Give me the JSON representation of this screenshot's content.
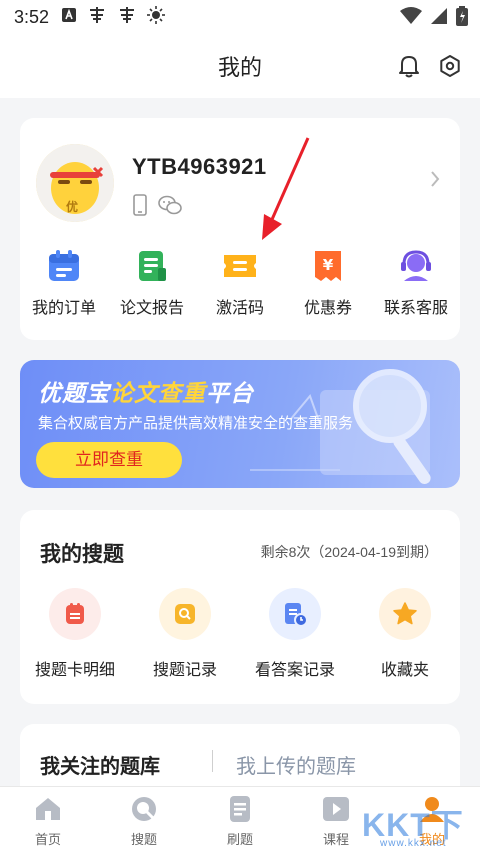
{
  "status_bar": {
    "time": "3:52"
  },
  "header": {
    "title": "我的"
  },
  "profile": {
    "username": "YTB4963921",
    "avatar_badge": "优"
  },
  "quick_actions": [
    {
      "label": "我的订单",
      "icon": "calendar-order-icon",
      "color": "#4f86f7"
    },
    {
      "label": "论文报告",
      "icon": "report-doc-icon",
      "color": "#32b25a"
    },
    {
      "label": "激活码",
      "icon": "ticket-code-icon",
      "color": "#ffb21a"
    },
    {
      "label": "优惠券",
      "icon": "coupon-yen-icon",
      "color": "#ff6b2c"
    },
    {
      "label": "联系客服",
      "icon": "headset-service-icon",
      "color": "#8a6cf5"
    }
  ],
  "banner": {
    "title_prefix": "优题宝",
    "title_highlight": "论文查重",
    "title_suffix": "平台",
    "subtitle": "集合权威官方产品提供高效精准安全的查重服务",
    "button": "立即查重"
  },
  "search": {
    "title": "我的搜题",
    "remaining": "剩余8次（2024-04-19到期）",
    "items": [
      {
        "label": "搜题卡明细",
        "icon": "card-detail-icon",
        "bg": "#fdecea",
        "color": "#f05a4a"
      },
      {
        "label": "搜题记录",
        "icon": "search-record-icon",
        "bg": "#fff4df",
        "color": "#f7b52a"
      },
      {
        "label": "看答案记录",
        "icon": "answer-record-icon",
        "bg": "#e8efff",
        "color": "#5b86f2"
      },
      {
        "label": "收藏夹",
        "icon": "favorite-star-icon",
        "bg": "#fff2df",
        "color": "#f7a823"
      }
    ]
  },
  "bank_tabs": {
    "followed": "我关注的题库",
    "uploaded": "我上传的题库"
  },
  "bottom_nav": [
    {
      "label": "首页",
      "icon": "home-icon",
      "active": false
    },
    {
      "label": "搜题",
      "icon": "search-tab-icon",
      "active": false
    },
    {
      "label": "刷题",
      "icon": "practice-doc-icon",
      "active": false
    },
    {
      "label": "课程",
      "icon": "course-play-icon",
      "active": false
    },
    {
      "label": "我的",
      "icon": "profile-tab-icon",
      "active": true
    }
  ],
  "watermark": {
    "text": "KKT下载",
    "url": "www.kkx.net"
  }
}
